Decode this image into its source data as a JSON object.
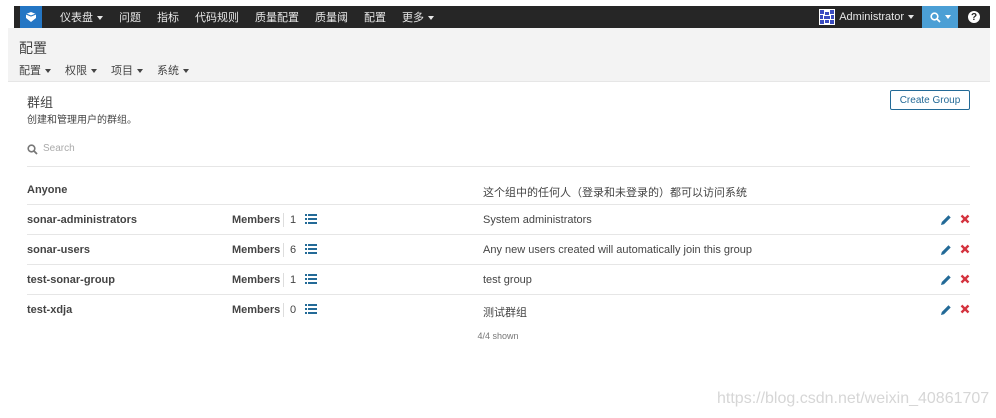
{
  "nav": {
    "items": [
      {
        "label": "仪表盘",
        "dropdown": true
      },
      {
        "label": "问题",
        "dropdown": false
      },
      {
        "label": "指标",
        "dropdown": false
      },
      {
        "label": "代码规则",
        "dropdown": false
      },
      {
        "label": "质量配置",
        "dropdown": false
      },
      {
        "label": "质量阈",
        "dropdown": false
      },
      {
        "label": "配置",
        "dropdown": false
      },
      {
        "label": "更多",
        "dropdown": true
      }
    ],
    "user": "Administrator",
    "help_label": "?"
  },
  "context": {
    "title": "配置",
    "menu": [
      "配置",
      "权限",
      "项目",
      "系统"
    ]
  },
  "page": {
    "title": "群组",
    "description": "创建和管理用户的群组。",
    "create_button": "Create Group"
  },
  "search": {
    "placeholder": "Search"
  },
  "groups": [
    {
      "name": "Anyone",
      "members_label": "",
      "count": "",
      "description": "这个组中的任何人（登录和未登录的）都可以访问系统",
      "editable": false
    },
    {
      "name": "sonar-administrators",
      "members_label": "Members",
      "count": "1",
      "description": "System administrators",
      "editable": true
    },
    {
      "name": "sonar-users",
      "members_label": "Members",
      "count": "6",
      "description": "Any new users created will automatically join this group",
      "editable": true
    },
    {
      "name": "test-sonar-group",
      "members_label": "Members",
      "count": "1",
      "description": "test group",
      "editable": true
    },
    {
      "name": "test-xdja",
      "members_label": "Members",
      "count": "0",
      "description": "测试群组",
      "editable": true
    }
  ],
  "footer": {
    "shown": "4/4 shown"
  },
  "watermark": "https://blog.csdn.net/weixin_40861707",
  "colors": {
    "topbar": "#262626",
    "accent": "#236a97",
    "search_button": "#4b9fd5",
    "delete": "#d4333f",
    "edit": "#236a97"
  }
}
